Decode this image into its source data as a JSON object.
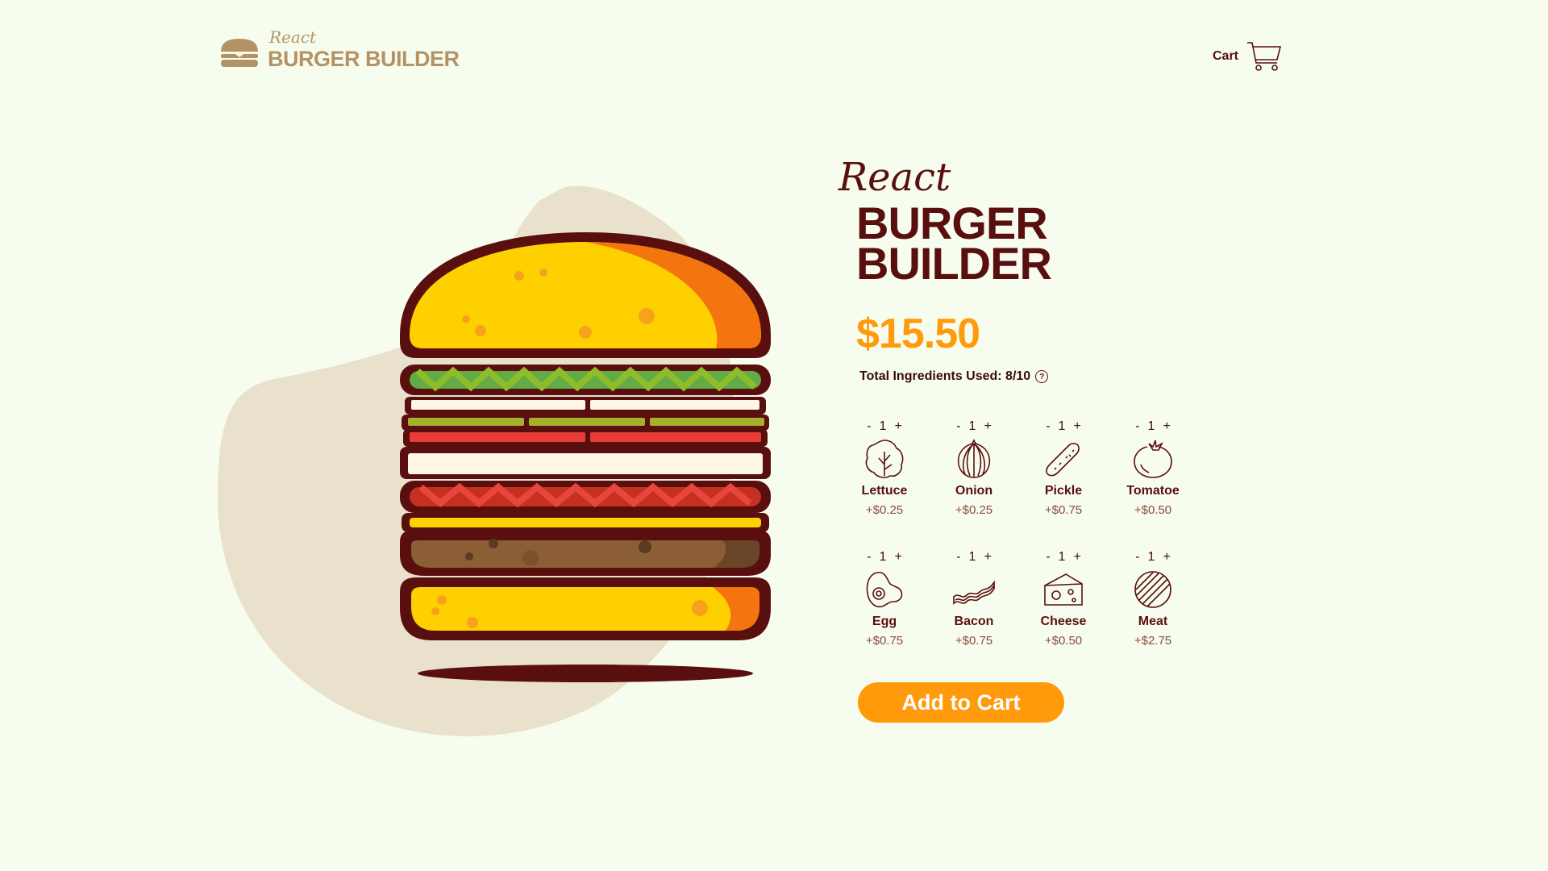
{
  "header": {
    "logo_script": "React",
    "logo_text": "BURGER BUILDER",
    "cart_label": "Cart"
  },
  "hero": {
    "script": "React",
    "title_line1": "BURGER",
    "title_line2": "BUILDER",
    "price": "$15.50",
    "total_label": "Total Ingredients Used: 8/10",
    "help_symbol": "?"
  },
  "ingredients": [
    {
      "name": "Lettuce",
      "price": "+$0.25",
      "count": "1",
      "icon": "lettuce-icon"
    },
    {
      "name": "Onion",
      "price": "+$0.25",
      "count": "1",
      "icon": "onion-icon"
    },
    {
      "name": "Pickle",
      "price": "+$0.75",
      "count": "1",
      "icon": "pickle-icon"
    },
    {
      "name": "Tomatoe",
      "price": "+$0.50",
      "count": "1",
      "icon": "tomato-icon"
    },
    {
      "name": "Egg",
      "price": "+$0.75",
      "count": "1",
      "icon": "egg-icon"
    },
    {
      "name": "Bacon",
      "price": "+$0.75",
      "count": "1",
      "icon": "bacon-icon"
    },
    {
      "name": "Cheese",
      "price": "+$0.50",
      "count": "1",
      "icon": "cheese-icon"
    },
    {
      "name": "Meat",
      "price": "+$2.75",
      "count": "1",
      "icon": "meat-icon"
    }
  ],
  "stepper": {
    "minus": "-",
    "plus": "+"
  },
  "add_to_cart": "Add to Cart",
  "colors": {
    "background": "#f7fdee",
    "brand_dark": "#5a0f0f",
    "accent_orange": "#ff9a0a",
    "logo_tan": "#b49265",
    "blob": "#e9e1cb"
  }
}
